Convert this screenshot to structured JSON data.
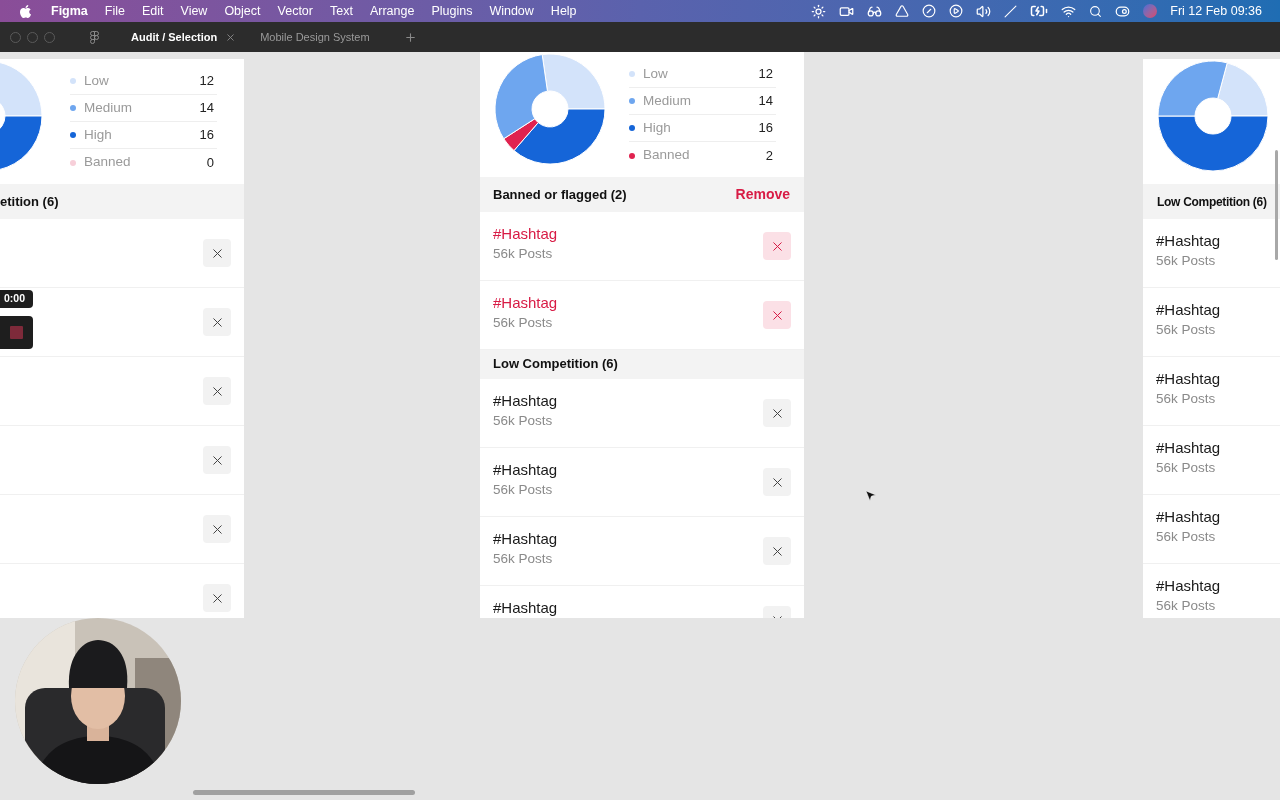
{
  "menu_bar": {
    "app": "Figma",
    "menus": [
      "File",
      "Edit",
      "View",
      "Object",
      "Vector",
      "Text",
      "Arrange",
      "Plugins",
      "Window",
      "Help"
    ],
    "clock": "Fri 12 Feb 09:36"
  },
  "tabs": [
    {
      "label": "Audit / Selection",
      "selected": true
    },
    {
      "label": "Mobile Design System",
      "selected": false
    }
  ],
  "frames": [
    {
      "kind": "cut_left",
      "legend": [
        {
          "label": "Low",
          "count": "12",
          "color": "#d3e3fa"
        },
        {
          "label": "Medium",
          "count": "14",
          "color": "#6ea6ef"
        },
        {
          "label": "High",
          "count": "16",
          "color": "#1565d8"
        },
        {
          "label": "Banned",
          "count": "0",
          "color": "#f7cfd9"
        }
      ],
      "sections": [
        {
          "title": "etition (6)",
          "rows": [
            {
              "kind": "normal"
            },
            {
              "kind": "normal"
            },
            {
              "kind": "normal"
            },
            {
              "kind": "normal"
            },
            {
              "kind": "normal"
            },
            {
              "kind": "normal"
            }
          ]
        }
      ]
    },
    {
      "kind": "full",
      "legend": [
        {
          "label": "Low",
          "count": "12",
          "color": "#d3e3fa"
        },
        {
          "label": "Medium",
          "count": "14",
          "color": "#6ea6ef"
        },
        {
          "label": "High",
          "count": "16",
          "color": "#1565d8"
        },
        {
          "label": "Banned",
          "count": "2",
          "color": "#e0224f"
        }
      ],
      "sections": [
        {
          "title": "Banned or flagged (2)",
          "action": "Remove",
          "rows": [
            {
              "kind": "banned",
              "tag": "#Hashtag",
              "posts": "56k Posts"
            },
            {
              "kind": "banned",
              "tag": "#Hashtag",
              "posts": "56k Posts"
            }
          ]
        },
        {
          "title": "Low Competition (6)",
          "rows": [
            {
              "kind": "normal",
              "tag": "#Hashtag",
              "posts": "56k Posts"
            },
            {
              "kind": "normal",
              "tag": "#Hashtag",
              "posts": "56k Posts"
            },
            {
              "kind": "normal",
              "tag": "#Hashtag",
              "posts": "56k Posts"
            },
            {
              "kind": "normal",
              "tag": "#Hashtag"
            }
          ]
        }
      ]
    },
    {
      "kind": "cut_right",
      "sections": [
        {
          "title": "Low Competition (6)",
          "rows": [
            {
              "kind": "normal",
              "tag": "#Hashtag",
              "posts": "56k Posts"
            },
            {
              "kind": "normal",
              "tag": "#Hashtag",
              "posts": "56k Posts"
            },
            {
              "kind": "normal",
              "tag": "#Hashtag",
              "posts": "56k Posts"
            },
            {
              "kind": "normal",
              "tag": "#Hashtag",
              "posts": "56k Posts"
            },
            {
              "kind": "normal",
              "tag": "#Hashtag",
              "posts": "56k Posts"
            },
            {
              "kind": "normal",
              "tag": "#Hashtag",
              "posts": "56k Posts"
            }
          ]
        }
      ]
    }
  ],
  "recording": {
    "time": "0:00"
  }
}
